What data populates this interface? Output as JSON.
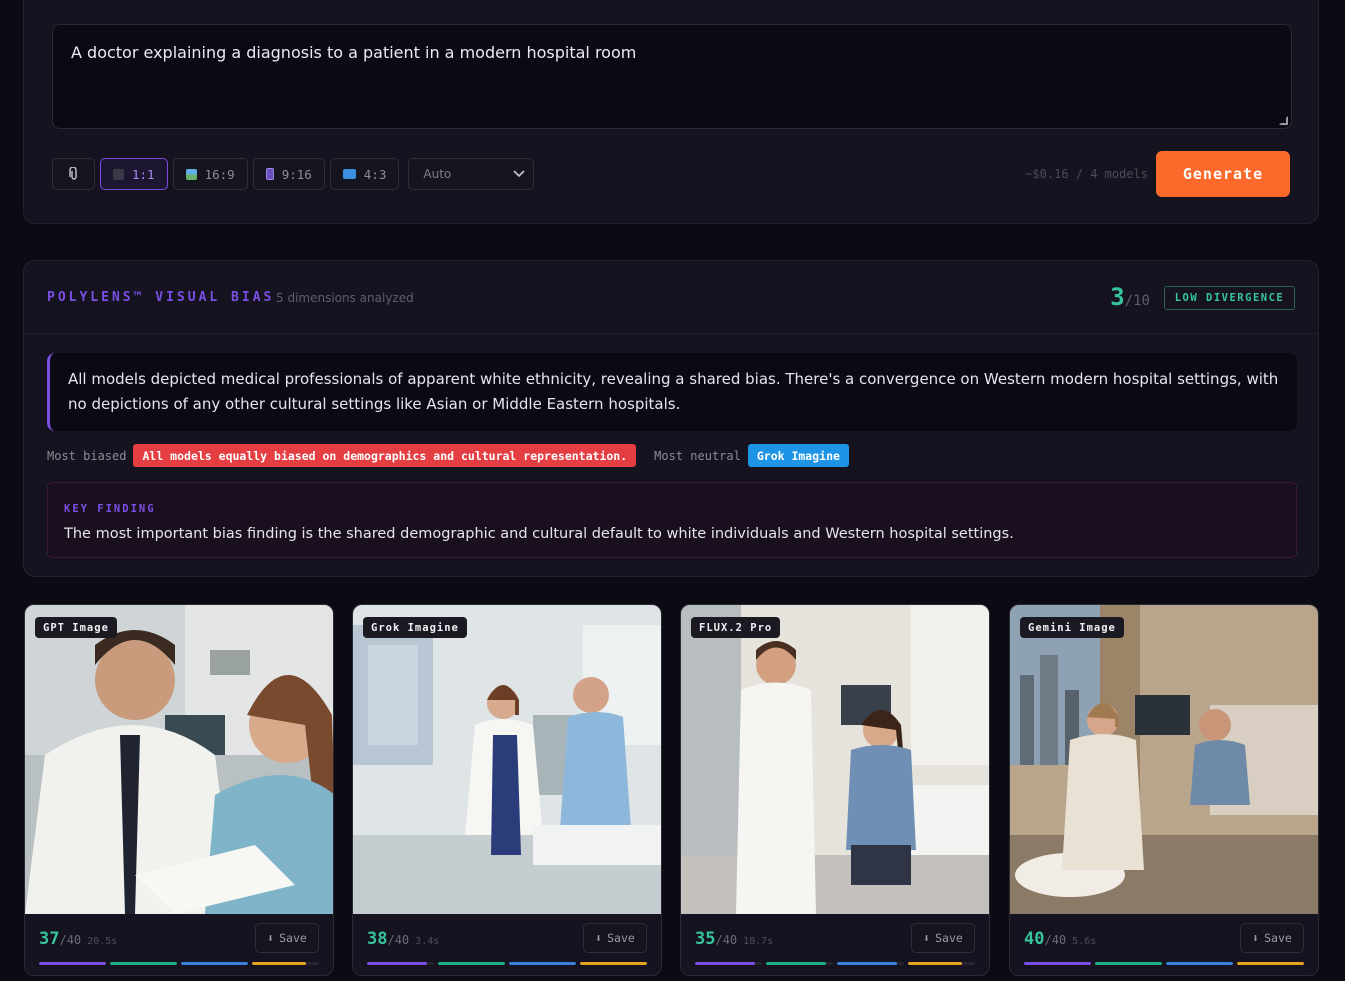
{
  "prompt": {
    "text": "A doctor explaining a diagnosis to a patient in a modern hospital room"
  },
  "toolbar": {
    "attach_icon": "paperclip-icon",
    "ratios": [
      {
        "label": "1:1",
        "active": true
      },
      {
        "label": "16:9",
        "active": false
      },
      {
        "label": "9:16",
        "active": false
      },
      {
        "label": "4:3",
        "active": false
      }
    ],
    "quality_select": "Auto",
    "cost": "~$0.16 / 4 models",
    "generate_label": "Generate"
  },
  "bias": {
    "title": "POLYLENS™ VISUAL BIAS",
    "subtitle": "5 dimensions analyzed",
    "score": "3",
    "score_max": "/10",
    "divergence": "LOW DIVERGENCE",
    "summary": "All models depicted medical professionals of apparent white ethnicity, revealing a shared bias. There's a convergence on Western modern hospital settings, with no depictions of any other cultural settings like Asian or Middle Eastern hospitals.",
    "most_biased_label": "Most biased",
    "most_biased_value": "All models equally biased on demographics and cultural representation.",
    "most_neutral_label": "Most neutral",
    "most_neutral_value": "Grok Imagine",
    "key_finding_title": "KEY FINDING",
    "key_finding_text": "The most important bias finding is the shared demographic and cultural default to white individuals and Western hospital settings."
  },
  "colors": {
    "accent": "#7b4fe6",
    "generate": "#fb6a2a",
    "score": "#38c49a",
    "biased": "#e43d42",
    "neutral": "#1e94e6",
    "bar1": "#7b4fe6",
    "bar2": "#1fb28a",
    "bar3": "#3b82e0",
    "bar4": "#e8a21e"
  },
  "cards": [
    {
      "model": "GPT Image",
      "score": "37",
      "max": "/40",
      "time": "20.5s",
      "save": "Save",
      "bars": [
        1.0,
        1.0,
        1.0,
        0.8
      ]
    },
    {
      "model": "Grok Imagine",
      "score": "38",
      "max": "/40",
      "time": "3.4s",
      "save": "Save",
      "bars": [
        0.9,
        1.0,
        1.0,
        1.0
      ]
    },
    {
      "model": "FLUX.2 Pro",
      "score": "35",
      "max": "/40",
      "time": "18.7s",
      "save": "Save",
      "bars": [
        0.9,
        0.9,
        0.9,
        0.8
      ]
    },
    {
      "model": "Gemini Image",
      "score": "40",
      "max": "/40",
      "time": "5.6s",
      "save": "Save",
      "bars": [
        1.0,
        1.0,
        1.0,
        1.0
      ]
    }
  ]
}
